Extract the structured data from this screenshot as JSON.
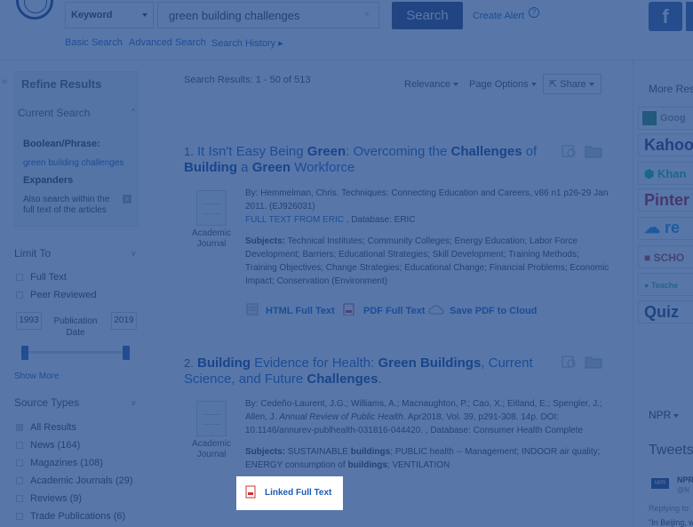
{
  "header": {
    "field_select": "Keyword",
    "search_value": "green building challenges",
    "search_button": "Search",
    "create_alert": "Create Alert",
    "help": "?",
    "facebook": "f",
    "subnav": {
      "basic": "Basic Search",
      "advanced": "Advanced Search",
      "history": "Search History ▸"
    }
  },
  "left_panel": {
    "collapse": "«",
    "refine_title": "Refine Results",
    "current_search": "Current Search",
    "boolean_title": "Boolean/Phrase:",
    "boolean_term": "green building challenges",
    "expanders_title": "Expanders",
    "expander_text": "Also search within the full text of the articles",
    "expander_remove": "x",
    "limit_to": "Limit To",
    "limits": [
      "Full Text",
      "Peer Reviewed"
    ],
    "year_from": "1993",
    "year_to": "2019",
    "publication_date": "Publication Date",
    "show_more": "Show More",
    "source_types_title": "Source Types",
    "source_types": [
      "All Results",
      "News (164)",
      "Magazines (108)",
      "Academic Journals (29)",
      "Reviews (9)",
      "Trade Publications (6)"
    ]
  },
  "results_header": {
    "count": "Search Results: 1 - 50 of 513",
    "relevance": "Relevance",
    "page_options": "Page Options",
    "share": "Share"
  },
  "results": [
    {
      "number": "1.",
      "title_parts": [
        "It Isn't Easy Being ",
        "Green",
        ": Overcoming the ",
        "Challenges",
        " of ",
        "Building",
        " a ",
        "Green",
        " Workforce"
      ],
      "doc_type": "Academic Journal",
      "meta_line1": "By: Hemmelman, Chris. Techniques: Connecting Education and Careers, v86 n1 p26-29 Jan 2011. (EJ926031)",
      "meta_link": "FULL TEXT FROM ERIC",
      "meta_db": " , Database: ERIC",
      "subjects_label": "Subjects:",
      "subjects": " Technical Institutes; Community Colleges; Energy Education; Labor Force Development; Barriers; Educational Strategies; Skill Development; Training Methods; Training Objectives; Change Strategies; Educational Change; Financial Problems; Economic Impact; Conservation (Environment)",
      "links": [
        "HTML Full Text",
        "PDF Full Text",
        "Save PDF to Cloud"
      ]
    },
    {
      "number": "2.",
      "title_parts": [
        "Building",
        " Evidence for Health: ",
        "Green Buildings",
        ", Current Science, and Future ",
        "Challenges",
        "."
      ],
      "doc_type": "Academic Journal",
      "meta_authors": "By: Cedeño-Laurent, J.G.; Williams, A.; Macnaughton, P.; Cao, X.; Eitland, E.; Spengler, J.; Allen, J.",
      "meta_journal": "Annual Review of Public Health",
      "meta_rest": ". Apr2018, Vol. 39, p291-308. 14p. DOI: 10.1146/annurev-publhealth-031816-044420. , Database: Consumer Health Complete",
      "subjects_label": "Subjects:",
      "subjects_parts": [
        " SUSTAINABLE ",
        "buildings",
        "; PUBLIC health -- Management; INDOOR air quality; ENERGY consumption of ",
        "buildings",
        "; VENTILATION"
      ],
      "linked_full_text": "Linked Full Text"
    }
  ],
  "right_panel": {
    "more_resources": "More Res",
    "externals": [
      "Goog",
      "Kahoot",
      "Khan",
      "Pinter",
      "re",
      "SCHO",
      "Teache",
      "Quiz"
    ],
    "npr_select": "NPR",
    "tweets": "Tweets",
    "tweet_badge": "NPR",
    "tweet_name": "NPR",
    "tweet_handle": "@N",
    "tweet_reply": "Replying to",
    "tweet_text": "\"In Beijing, w"
  },
  "colors": {
    "overlay": "#1e488a",
    "link": "#1a5bb5",
    "search_button": "#2a3f6e",
    "facebook": "#3b5998"
  }
}
